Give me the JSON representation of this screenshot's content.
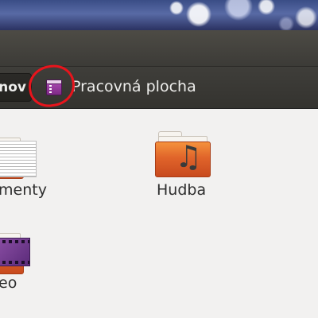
{
  "pathbar": {
    "previous_label": "nov",
    "current_label": "Pracovná plocha",
    "current_icon": "desktop-folder-icon"
  },
  "files": [
    {
      "label": "menty",
      "icon": "documents-folder-icon"
    },
    {
      "label": "Hudba",
      "icon": "music-folder-icon"
    },
    {
      "label": "eo",
      "icon": "video-folder-icon"
    }
  ],
  "colors": {
    "titlebar": "#3c3b37",
    "content_background": "#f2f1f0",
    "folder_orange": "#e0642a",
    "annotation_red": "#e8141c"
  }
}
